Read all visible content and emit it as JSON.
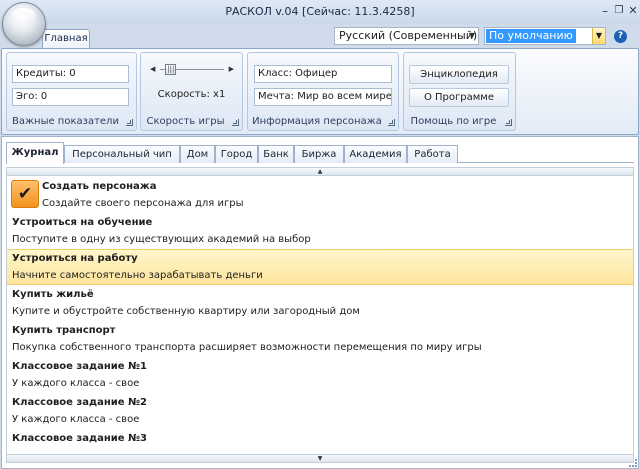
{
  "window": {
    "title": "РАСКОЛ v.04 [Сейчас: 11.3.4258]",
    "minimize_glyph": "–",
    "restore_glyph": "❐",
    "close_glyph": "✕"
  },
  "ribbon": {
    "home_tab": "Главная",
    "language": "Русский (Современный)",
    "theme": "По умолчанию",
    "help_glyph": "?",
    "groups": {
      "stats": {
        "caption": "Важные показатели",
        "credits": "Кредиты: 0",
        "ego": "Эго: 0"
      },
      "speed": {
        "caption": "Скорость игры",
        "label": "Скорость: x1",
        "level_percent": 10
      },
      "character": {
        "caption": "Информация персонажа",
        "class": "Класс: Офицер",
        "dream": "Мечта: Мир во всем мире"
      },
      "help": {
        "caption": "Помощь по игре",
        "encyclopedia": "Энциклопедия",
        "about": "О Программе"
      }
    }
  },
  "tabs": [
    "Журнал",
    "Персональный чип",
    "Дом",
    "Город",
    "Банк",
    "Биржа",
    "Академия",
    "Работа"
  ],
  "active_tab": "Журнал",
  "tasks": [
    {
      "title": "Создать персонажа",
      "desc": "Создайте своего персонажа для игры",
      "completed": true
    },
    {
      "title": "Устроиться на обучение",
      "desc": "Поступите в одну из существующих академий на выбор"
    },
    {
      "title": "Устроиться на работу",
      "desc": "Начните самостоятельно зарабатывать деньги",
      "selected": true
    },
    {
      "title": "Купить жильё",
      "desc": "Купите и обустройте собственную квартиру или загородный дом"
    },
    {
      "title": "Купить транспорт",
      "desc": "Покупка собственного транспорта расширяет возможности перемещения по миру игры"
    },
    {
      "title": "Классовое задание №1",
      "desc": "У каждого класса - свое"
    },
    {
      "title": "Классовое задание №2",
      "desc": "У каждого класса - свое"
    },
    {
      "title": "Классовое задание №3",
      "desc": ""
    }
  ],
  "colors": {
    "selection": "#fde49d",
    "accent": "#f2921e",
    "ribbon": "#dfe9f5"
  },
  "icons": {
    "completed": "check-icon",
    "help": "help-icon"
  }
}
